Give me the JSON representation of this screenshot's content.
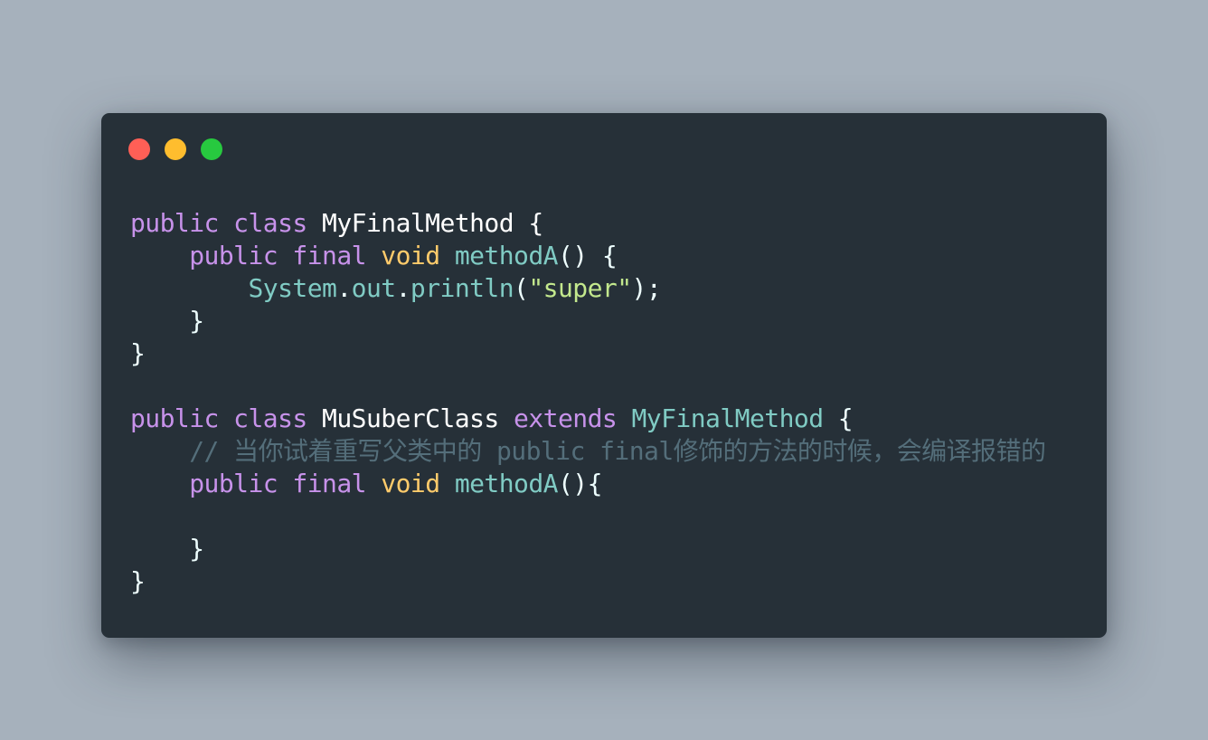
{
  "window": {
    "controls": [
      {
        "name": "close",
        "color": "#ff5f56"
      },
      {
        "name": "minimize",
        "color": "#ffbd2e"
      },
      {
        "name": "zoom",
        "color": "#27c93f"
      }
    ]
  },
  "code": {
    "language": "java",
    "lines": [
      [
        {
          "t": "public",
          "k": "kw"
        },
        {
          "t": " ",
          "k": "pn"
        },
        {
          "t": "class",
          "k": "kw"
        },
        {
          "t": " MyFinalMethod {",
          "k": "cls"
        }
      ],
      [
        {
          "t": "    ",
          "k": "pn"
        },
        {
          "t": "public",
          "k": "kw"
        },
        {
          "t": " ",
          "k": "pn"
        },
        {
          "t": "final",
          "k": "kw"
        },
        {
          "t": " ",
          "k": "pn"
        },
        {
          "t": "void",
          "k": "ty"
        },
        {
          "t": " ",
          "k": "pn"
        },
        {
          "t": "methodA",
          "k": "obj"
        },
        {
          "t": "() {",
          "k": "pn"
        }
      ],
      [
        {
          "t": "        ",
          "k": "pn"
        },
        {
          "t": "System",
          "k": "obj"
        },
        {
          "t": ".",
          "k": "pn"
        },
        {
          "t": "out",
          "k": "obj"
        },
        {
          "t": ".",
          "k": "pn"
        },
        {
          "t": "println",
          "k": "obj"
        },
        {
          "t": "(",
          "k": "pn"
        },
        {
          "t": "\"super\"",
          "k": "str"
        },
        {
          "t": ");",
          "k": "pn"
        }
      ],
      [
        {
          "t": "    }",
          "k": "pn"
        }
      ],
      [
        {
          "t": "}",
          "k": "pn"
        }
      ],
      [],
      [
        {
          "t": "public",
          "k": "kw"
        },
        {
          "t": " ",
          "k": "pn"
        },
        {
          "t": "class",
          "k": "kw"
        },
        {
          "t": " MuSuberClass ",
          "k": "cls"
        },
        {
          "t": "extends",
          "k": "kw"
        },
        {
          "t": " ",
          "k": "pn"
        },
        {
          "t": "MyFinalMethod",
          "k": "obj"
        },
        {
          "t": " {",
          "k": "pn"
        }
      ],
      [
        {
          "t": "    ",
          "k": "pn"
        },
        {
          "t": "// 当你试着重写父类中的 public final修饰的方法的时候，会编译报错的",
          "k": "cm"
        }
      ],
      [
        {
          "t": "    ",
          "k": "pn"
        },
        {
          "t": "public",
          "k": "kw"
        },
        {
          "t": " ",
          "k": "pn"
        },
        {
          "t": "final",
          "k": "kw"
        },
        {
          "t": " ",
          "k": "pn"
        },
        {
          "t": "void",
          "k": "ty"
        },
        {
          "t": " ",
          "k": "pn"
        },
        {
          "t": "methodA",
          "k": "obj"
        },
        {
          "t": "(){",
          "k": "pn"
        }
      ],
      [],
      [
        {
          "t": "    }",
          "k": "pn"
        }
      ],
      [
        {
          "t": "}",
          "k": "pn"
        }
      ]
    ]
  }
}
